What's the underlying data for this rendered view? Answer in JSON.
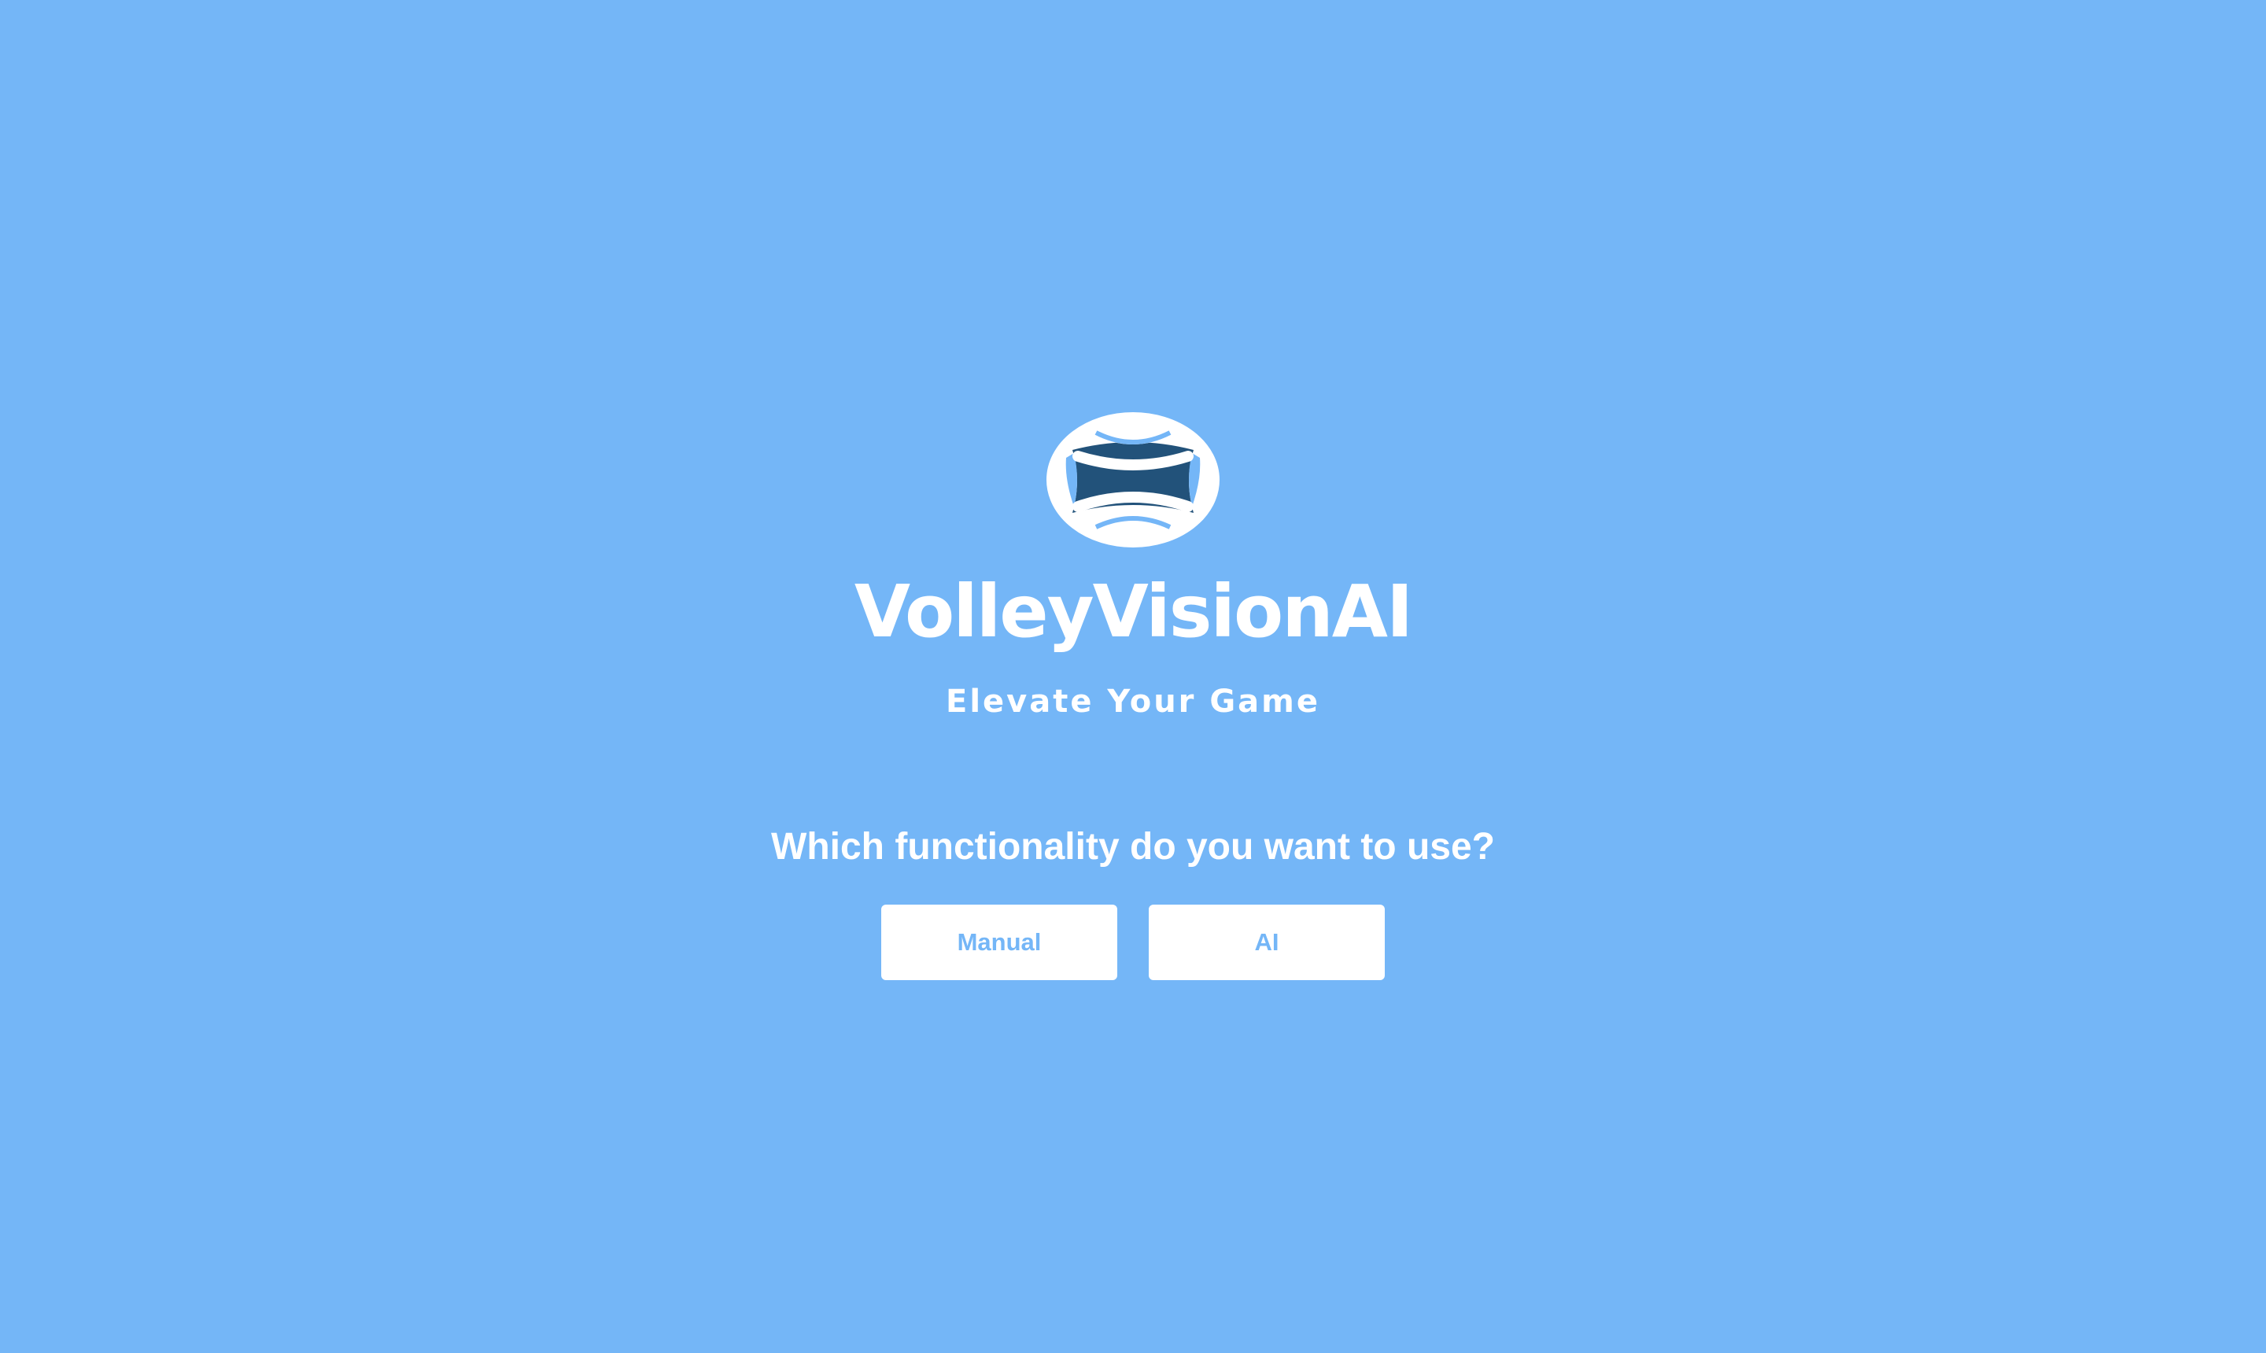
{
  "brand": {
    "name": "VolleyVisionAI",
    "tagline": "Elevate Your Game",
    "logo_icon": "volleyball-icon"
  },
  "prompt": {
    "question": "Which functionality do you want to use?"
  },
  "options": {
    "manual_label": "Manual",
    "ai_label": "AI"
  },
  "colors": {
    "background": "#74b6f7",
    "foreground": "#ffffff",
    "logo_dark": "#22527a",
    "button_text": "#74b6f7"
  }
}
